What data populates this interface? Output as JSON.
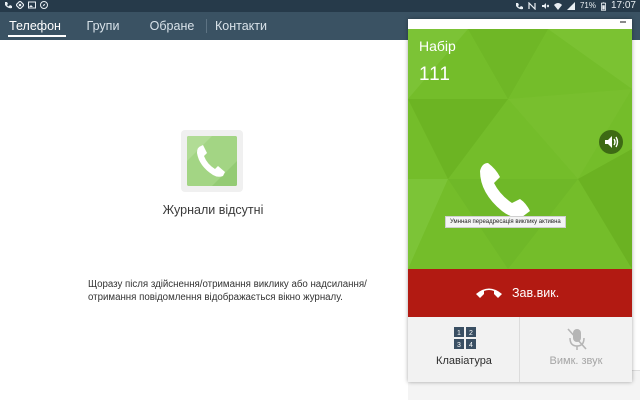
{
  "status_bar": {
    "time": "17:07",
    "battery": "71%",
    "left_icons": [
      "missed-call-icon",
      "location-icon",
      "image-icon",
      "compass-icon"
    ],
    "right_icons": [
      "call-icon",
      "nfc-icon",
      "mute-icon",
      "wifi-icon",
      "signal-icon",
      "battery-icon"
    ]
  },
  "tabs": [
    {
      "label": "Телефон",
      "active": true
    },
    {
      "label": "Групи",
      "active": false
    },
    {
      "label": "Обране",
      "active": false
    },
    {
      "label": "Контакти",
      "active": false
    }
  ],
  "empty_log": {
    "icon": "phone-icon",
    "title": "Журнали відсутні",
    "description": "Щоразу після здійснення/отримання виклику або надсилання/отримання повідомлення відображається вікно журналу."
  },
  "call_popup": {
    "title": "Набір",
    "number": "111",
    "speaker_icon": "speaker-icon",
    "handset_icon": "handset-icon",
    "tooltip": "Умнная переадресація виклику активна",
    "end_call_label": "Зав.вик.",
    "keypad_label": "Клавіатура",
    "mute_label": "Вимк. звук",
    "colors": {
      "green": "#74bd2a",
      "end_call": "#b21a12",
      "tab_bar": "#3a5263"
    }
  }
}
